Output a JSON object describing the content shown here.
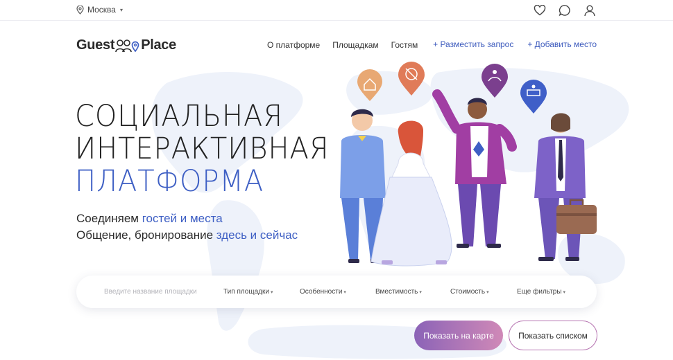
{
  "topbar": {
    "city": "Москва",
    "icons": [
      "heart-icon",
      "chat-icon",
      "user-icon"
    ]
  },
  "header": {
    "logo_left": "Guest",
    "logo_right": "Place",
    "menu": [
      "О платформе",
      "Площадкам",
      "Гостям"
    ],
    "actions": [
      "+ Разместить запрос",
      "+ Добавить место"
    ]
  },
  "hero": {
    "title_line1": "СОЦИАЛЬНАЯ",
    "title_line2": "ИНТЕРАКТИВНАЯ",
    "title_line3": "ПЛАТФОРМА",
    "sub1_text": "Соединяем ",
    "sub1_accent": "гостей и места",
    "sub2_text": "Общение, бронирование ",
    "sub2_accent": "здесь и сейчас"
  },
  "search": {
    "placeholder": "Введите название площадки",
    "filters": [
      "Тип площадки",
      "Особенности",
      "Вместимость",
      "Стоимость",
      "Еще фильтры"
    ]
  },
  "buttons": {
    "map": "Показать на карте",
    "list": "Показать списком"
  },
  "colors": {
    "accent": "#3e5fc4",
    "gradient_start": "#8b63b7",
    "gradient_end": "#d089b7"
  }
}
